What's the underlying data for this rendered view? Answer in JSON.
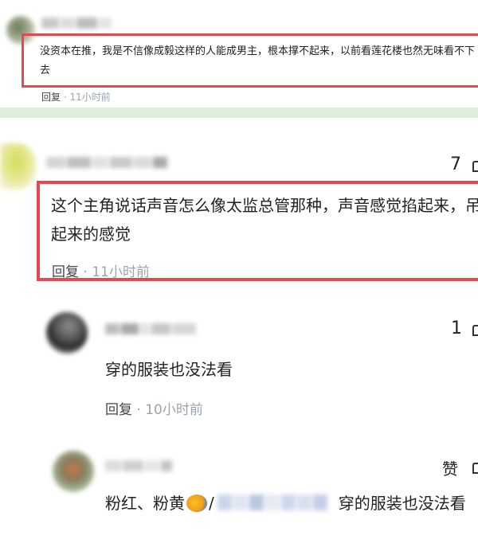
{
  "top_comment": {
    "text": "没资本在推，我是不信像成毅这样的人能成男主，根本撑不起来，以前看莲花楼也然无味看不下去",
    "reply_label": "回复",
    "separator": "·",
    "time": "11小时前"
  },
  "comment_2": {
    "likes": "7",
    "text": "这个主角说话声音怎么像太监总管那种，声音感觉掐起来，吊起来的感觉",
    "reply_label": "回复",
    "separator": "·",
    "time": "11小时前"
  },
  "reply_1": {
    "likes": "1",
    "text": "穿的服装也没法看",
    "reply_label": "回复",
    "separator": "·",
    "time": "10小时前"
  },
  "reply_2": {
    "likes_label": "赞",
    "text_prefix": "粉红、粉黄",
    "text_slash": "/",
    "text_suffix": "穿的服装也没法看"
  },
  "icons": {
    "like": "thumbs-up-icon"
  },
  "colors": {
    "highlight_border": "#e8474f",
    "divider": "#dff0da",
    "time_text": "#9aa3b0"
  }
}
